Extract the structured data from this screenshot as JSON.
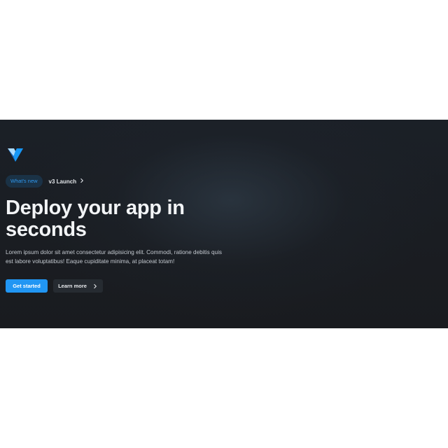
{
  "brand": {
    "logo_icon": "vuetify-logo-icon",
    "primary_color": "#2196f3",
    "accent_color": "#1867c0"
  },
  "hero": {
    "badge": {
      "label": "What's new",
      "text": "v3 Launch",
      "icon": "chevron-right-icon"
    },
    "title": "Deploy your app in seconds",
    "description": "Lorem ipsum dolor sit amet consectetur adipisicing elit. Commodi, ratione debitis quis est labore voluptatibus! Eaque cupiditate minima, at placeat totam!",
    "primary_button": {
      "label": "Get started"
    },
    "secondary_button": {
      "label": "Learn more",
      "icon": "chevron-right-icon"
    }
  }
}
